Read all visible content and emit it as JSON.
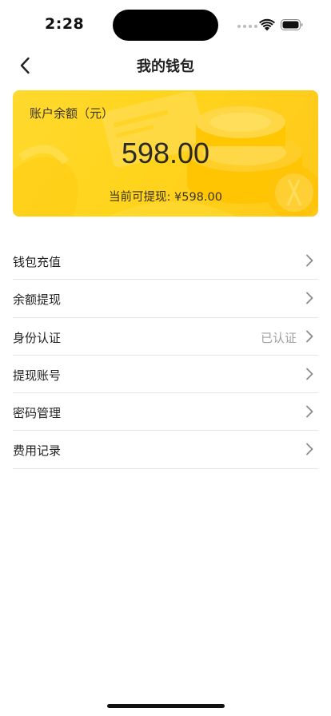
{
  "status_bar": {
    "time": "2:28"
  },
  "nav": {
    "title": "我的钱包",
    "back_icon": "chevron-left-icon"
  },
  "wallet_card": {
    "label": "账户余额（元）",
    "amount": "598.00",
    "withdrawable": "当前可提现: ¥598.00",
    "background_color": "#ffd41c"
  },
  "menu": {
    "items": [
      {
        "label": "钱包充值",
        "value": ""
      },
      {
        "label": "余额提现",
        "value": ""
      },
      {
        "label": "身份认证",
        "value": "已认证"
      },
      {
        "label": "提现账号",
        "value": ""
      },
      {
        "label": "密码管理",
        "value": ""
      },
      {
        "label": "费用记录",
        "value": ""
      }
    ]
  }
}
